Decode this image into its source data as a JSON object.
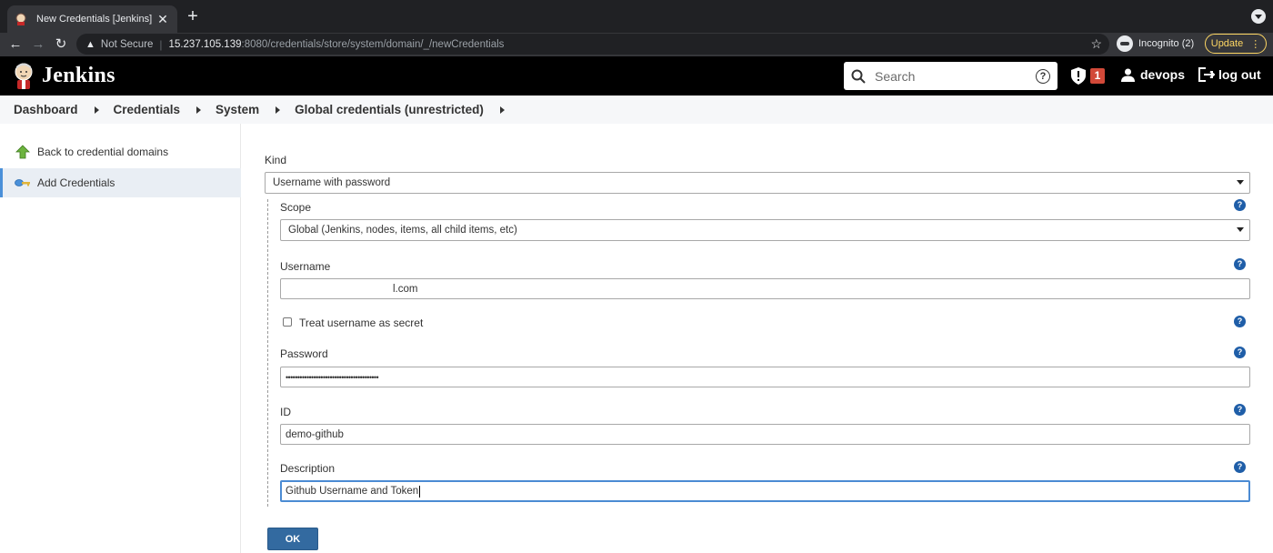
{
  "browser": {
    "tab_title": "New Credentials [Jenkins]",
    "tab_close": "✕",
    "new_tab": "+",
    "not_secure": "Not Secure",
    "url_host": "15.237.105.139",
    "url_path": ":8080/credentials/store/system/domain/_/newCredentials",
    "incognito_label": "Incognito (2)",
    "update_label": "Update"
  },
  "header": {
    "title": "Jenkins",
    "search_placeholder": "Search",
    "search_help": "?",
    "alert_count": "1",
    "username": "devops",
    "logout_label": "log out"
  },
  "breadcrumb": [
    "Dashboard",
    "Credentials",
    "System",
    "Global credentials (unrestricted)"
  ],
  "sidebar": {
    "items": [
      {
        "label": "Back to credential domains",
        "icon": "up-arrow-icon"
      },
      {
        "label": "Add Credentials",
        "icon": "key-icon"
      }
    ]
  },
  "form": {
    "kind_label": "Kind",
    "kind_value": "Username with password",
    "scope_label": "Scope",
    "scope_value": "Global (Jenkins, nodes, items, all child items, etc)",
    "username_label": "Username",
    "username_value": "l.com",
    "treat_secret_label": "Treat username as secret",
    "treat_secret_checked": false,
    "password_label": "Password",
    "password_value": "••••••••••••••••••••••••••••••••••••••••",
    "id_label": "ID",
    "id_value": "demo-github",
    "description_label": "Description",
    "description_value": "Github Username and Token",
    "help_glyph": "?",
    "ok_label": "OK"
  },
  "colors": {
    "header_bg": "#000000",
    "ok_button": "#336aa0",
    "help_icon": "#1f5ea8",
    "alert_badge": "#d24939",
    "focus_border": "#4b8bd3"
  }
}
